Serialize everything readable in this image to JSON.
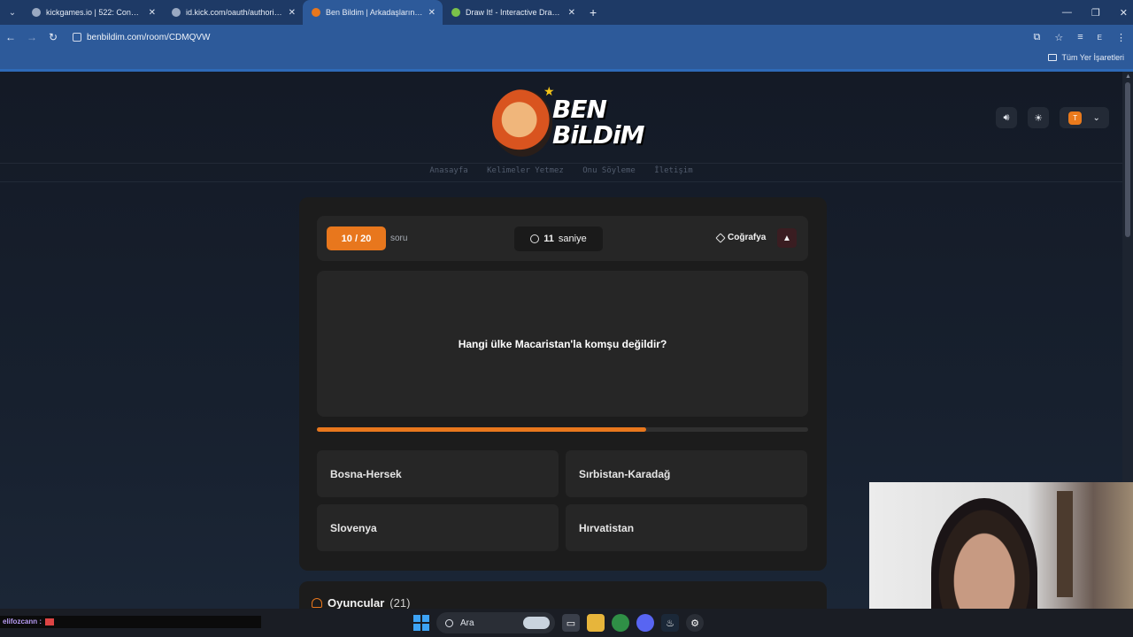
{
  "browser": {
    "tabs": [
      {
        "title": "kickgames.io | 522: Connection",
        "active": false
      },
      {
        "title": "id.kick.com/oauth/authorize?re",
        "active": false
      },
      {
        "title": "Ben Bildim | Arkadaşlarınla Onl",
        "active": true
      },
      {
        "title": "Draw It! - Interactive Drawing G",
        "active": false
      }
    ],
    "url": "benbildim.com/room/CDMQVW",
    "bookmarks_label": "Tüm Yer İşaretleri"
  },
  "site": {
    "logo_line1": "BEN",
    "logo_line2": "BiLDiM",
    "nav": [
      "Anasayfa",
      "Kelimeler Yetmez",
      "Onu Söyleme",
      "İletişim"
    ],
    "user_initial": "T"
  },
  "quiz": {
    "counter": "10 / 20",
    "counter_label": "soru",
    "timer_value": "11",
    "timer_unit": "saniye",
    "category": "Coğrafya",
    "question": "Hangi ülke Macaristan'la komşu değildir?",
    "progress_percent": 67,
    "answers": [
      "Bosna-Hersek",
      "Sırbistan-Karadağ",
      "Slovenya",
      "Hırvatistan"
    ]
  },
  "players": {
    "title": "Oyuncular",
    "count": "(21)"
  },
  "taskbar": {
    "search_label": "Ara",
    "chat_user": "elifozcann :"
  },
  "colors": {
    "accent": "#e8771d",
    "browser_blue": "#2d5a9a"
  }
}
